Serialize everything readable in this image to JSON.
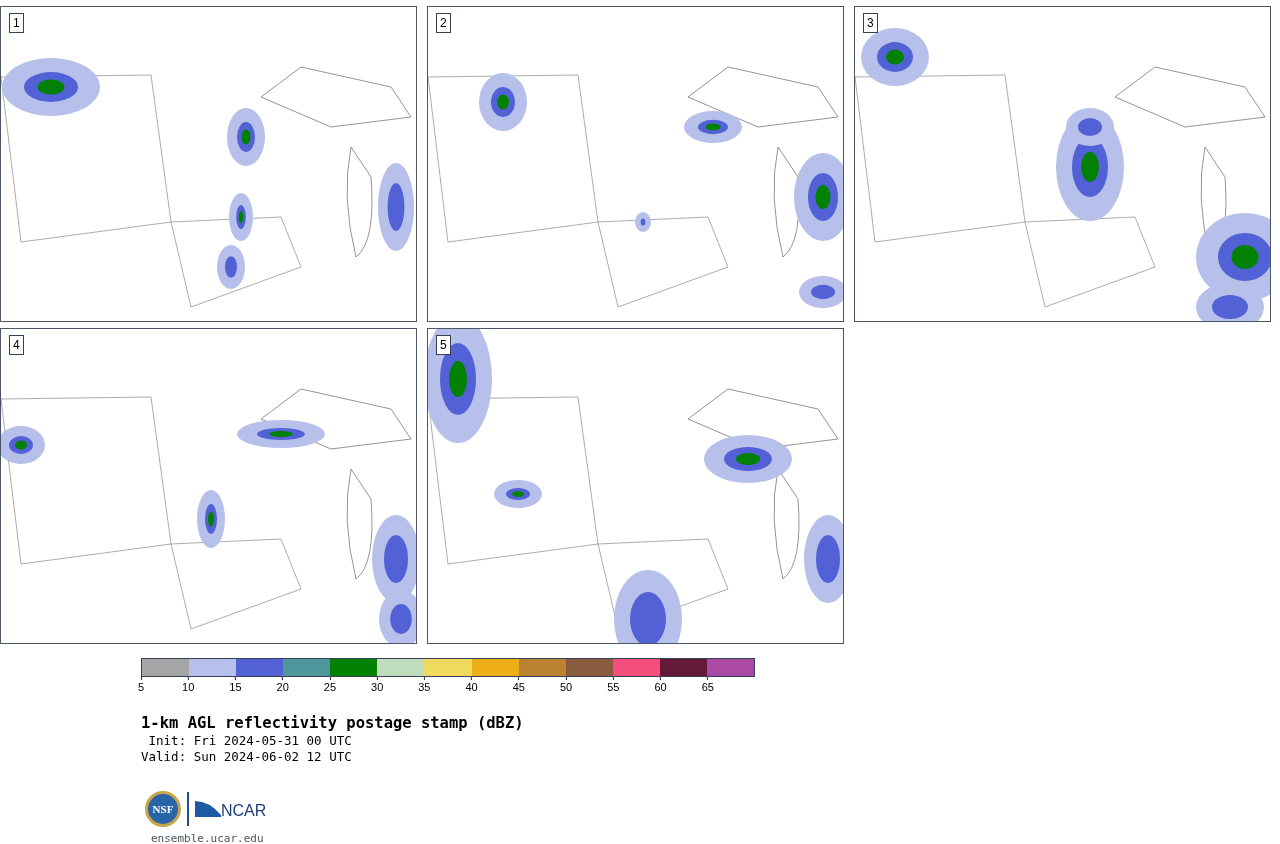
{
  "panels": [
    {
      "label": "1"
    },
    {
      "label": "2"
    },
    {
      "label": "3"
    },
    {
      "label": "4"
    },
    {
      "label": "5"
    }
  ],
  "colorbar": {
    "bins": [
      {
        "color": "#a5a5a5"
      },
      {
        "color": "#b7c0ea"
      },
      {
        "color": "#5361d6"
      },
      {
        "color": "#4e979c"
      },
      {
        "color": "#028102"
      },
      {
        "color": "#bfdcbd"
      },
      {
        "color": "#efd95e"
      },
      {
        "color": "#eeae18"
      },
      {
        "color": "#bb8232"
      },
      {
        "color": "#8a5a3e"
      },
      {
        "color": "#f44f7c"
      },
      {
        "color": "#641936"
      },
      {
        "color": "#ab4aa5"
      }
    ],
    "ticks": [
      "5",
      "10",
      "15",
      "20",
      "25",
      "30",
      "35",
      "40",
      "45",
      "50",
      "55",
      "60",
      "65"
    ]
  },
  "title": "1-km AGL reflectivity postage stamp (dBZ)",
  "init": " Init: Fri 2024-05-31 00 UTC",
  "valid": "Valid: Sun 2024-06-02 12 UTC",
  "logos": {
    "nsf": "NSF",
    "ncar": "NCAR"
  },
  "url": "ensemble.ucar.edu"
}
